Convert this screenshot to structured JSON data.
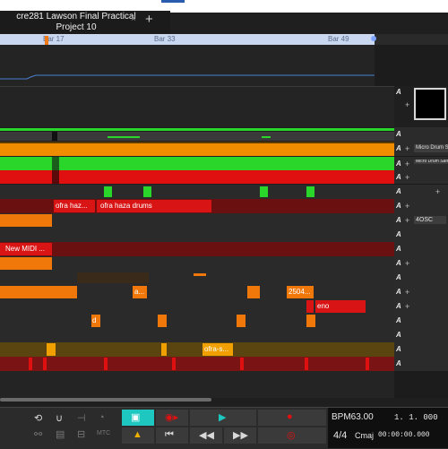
{
  "window": {
    "tab_title": "cre281 Lawson Final Practical Project 10",
    "tab_close": "×",
    "tab_add": "+"
  },
  "ruler": {
    "bar_labels": [
      "Bar 17",
      "Bar 33",
      "Bar 49"
    ]
  },
  "track_header": {
    "automation_label": "A",
    "add_label": "+",
    "device_labels": [
      "Micro Drum S",
      "Micro Drum Sampler",
      "4OSC"
    ]
  },
  "clips": {
    "ofra_1": "ofra haz...",
    "ofra_2": "ofra haza drums",
    "new_midi": "New MIDI ...",
    "clip_a": "a...",
    "clip_2504": "2504...",
    "clip_eno": "eno",
    "clip_d": "d",
    "clip_ofra_s": "ofra-s..."
  },
  "transport": {
    "bpm": "BPM63.00",
    "position": "1. 1. 000",
    "time_sig": "4/4",
    "key": "Cmaj",
    "time": "00:00:00.000",
    "mtc_label": "MTC"
  },
  "colors": {
    "green": "#2bd62b",
    "orange": "#f08c00",
    "red": "#e01010",
    "dark_red": "#7a1414",
    "cyan": "#1ec8c0",
    "ruler": "#c9d7f0"
  }
}
